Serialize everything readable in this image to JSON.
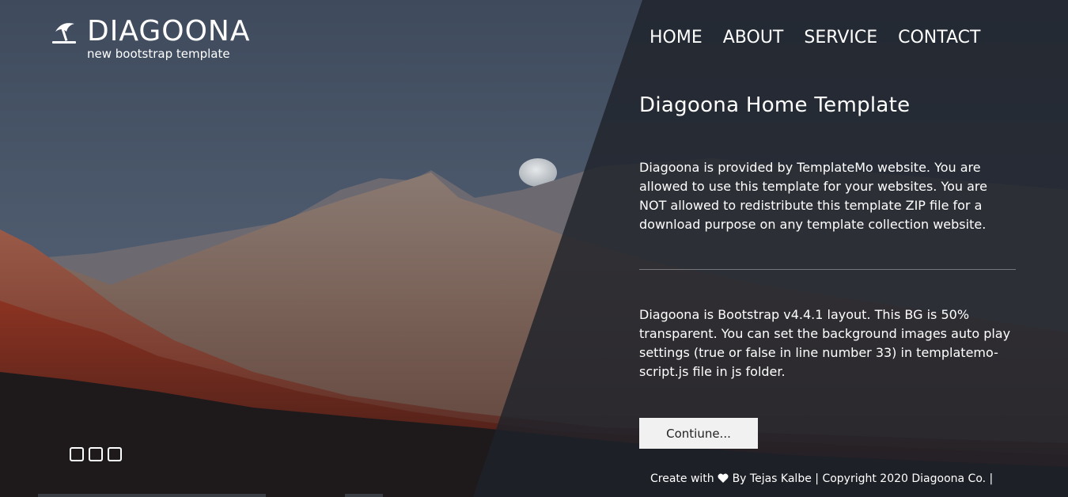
{
  "brand": {
    "title": "DIAGOONA",
    "subtitle": "new bootstrap template",
    "icon": "beach-umbrella-icon"
  },
  "nav": {
    "items": [
      "HOME",
      "ABOUT",
      "SERVICE",
      "CONTACT"
    ]
  },
  "main": {
    "heading": "Diagoona Home Template",
    "paragraph1": "Diagoona is provided by TemplateMo website. You are allowed to use this template for your websites. You are NOT allowed to redistribute this template ZIP file for a download purpose on any template collection website.",
    "paragraph2": "Diagoona is Bootstrap v4.4.1 layout. This BG is 50% transparent. You can set the background images auto play settings (true or false in line number 33) in templatemo-script.js file in js folder.",
    "button_label": "Contiune..."
  },
  "footer": {
    "prefix": "Create with",
    "icon": "heart-icon",
    "suffix": "By Tejas Kalbe | Copyright 2020 Diagoona Co. |"
  },
  "slider": {
    "dot_count": 3
  },
  "colors": {
    "panel": "#1e222a",
    "button_bg": "#f1f1f1",
    "button_text": "#222222"
  }
}
